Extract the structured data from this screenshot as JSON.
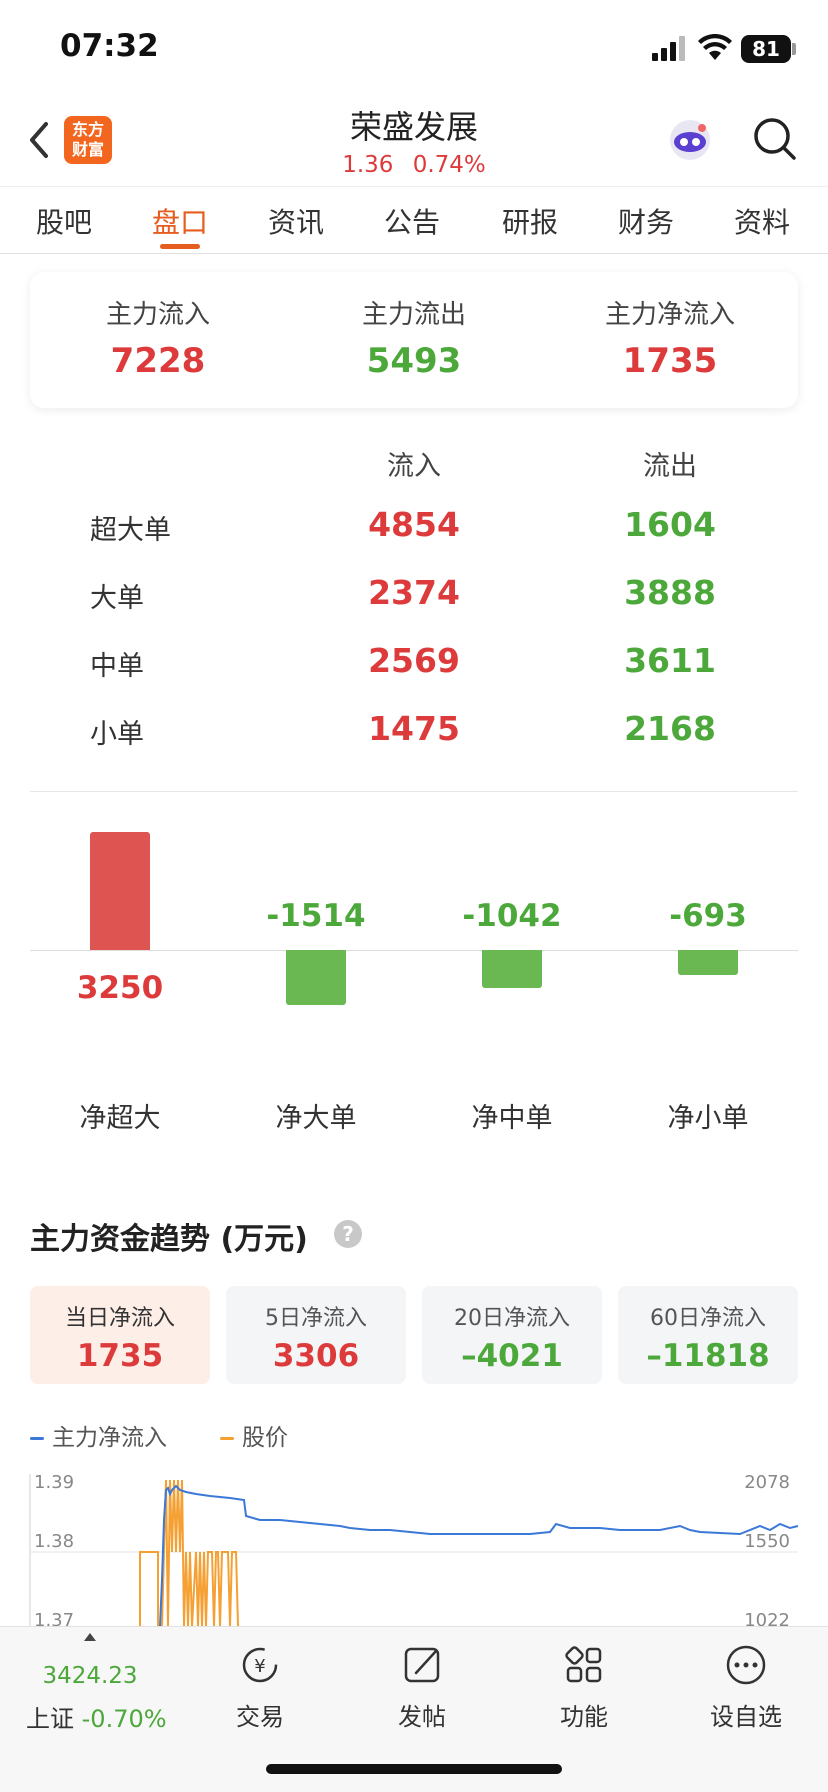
{
  "status_bar": {
    "time": "07:32",
    "battery": "81"
  },
  "header": {
    "title": "荣盛发展",
    "price": "1.36",
    "change_pct": "0.74%",
    "logo_text_1": "东方",
    "logo_text_2": "财富"
  },
  "tabs": [
    {
      "label": "股吧"
    },
    {
      "label": "盘口"
    },
    {
      "label": "资讯"
    },
    {
      "label": "公告"
    },
    {
      "label": "研报"
    },
    {
      "label": "财务"
    },
    {
      "label": "资料"
    }
  ],
  "active_tab": "盘口",
  "main_flow": [
    {
      "label": "主力流入",
      "value": "7228"
    },
    {
      "label": "主力流出",
      "value": "5493"
    },
    {
      "label": "主力净流入",
      "value": "1735"
    }
  ],
  "flow_table": {
    "headers": {
      "inflow": "流入",
      "outflow": "流出"
    },
    "rows": [
      {
        "label": "超大单",
        "inflow": "4854",
        "outflow": "1604"
      },
      {
        "label": "大单",
        "inflow": "2374",
        "outflow": "3888"
      },
      {
        "label": "中单",
        "inflow": "2569",
        "outflow": "3611"
      },
      {
        "label": "小单",
        "inflow": "1475",
        "outflow": "2168"
      }
    ]
  },
  "chart_data": [
    {
      "type": "bar",
      "categories": [
        "净超大",
        "净大单",
        "净中单",
        "净小单"
      ],
      "values": [
        3250,
        -1514,
        -1042,
        -693
      ],
      "colors": {
        "positive": "#dd5450",
        "negative": "#6ab851"
      }
    },
    {
      "type": "line",
      "series": [
        {
          "name": "主力净流入",
          "color": "#3b78d8"
        },
        {
          "name": "股价",
          "color": "#f5a033"
        }
      ],
      "y_left_ticks": [
        "1.39",
        "1.38",
        "1.37"
      ],
      "y_right_ticks": [
        "2078",
        "1550",
        "1022"
      ]
    }
  ],
  "trend": {
    "title": "主力资金趋势 (万元)",
    "help_icon": "?",
    "stats": [
      {
        "label": "当日净流入",
        "value": "1735"
      },
      {
        "label": "5日净流入",
        "value": "3306"
      },
      {
        "label": "20日净流入",
        "value": "–4021"
      },
      {
        "label": "60日净流入",
        "value": "–11818"
      }
    ],
    "legend": [
      {
        "label": "主力净流入",
        "color": "#3b78d8"
      },
      {
        "label": "股价",
        "color": "#f5a033"
      }
    ]
  },
  "bottom_nav": {
    "index_value": "3424.23",
    "index_name": "上证",
    "index_change": "-0.70%",
    "items": [
      {
        "label": "交易",
        "icon": "trade-icon"
      },
      {
        "label": "发帖",
        "icon": "edit-icon"
      },
      {
        "label": "功能",
        "icon": "grid-icon"
      },
      {
        "label": "设自选",
        "icon": "more-icon"
      }
    ]
  }
}
